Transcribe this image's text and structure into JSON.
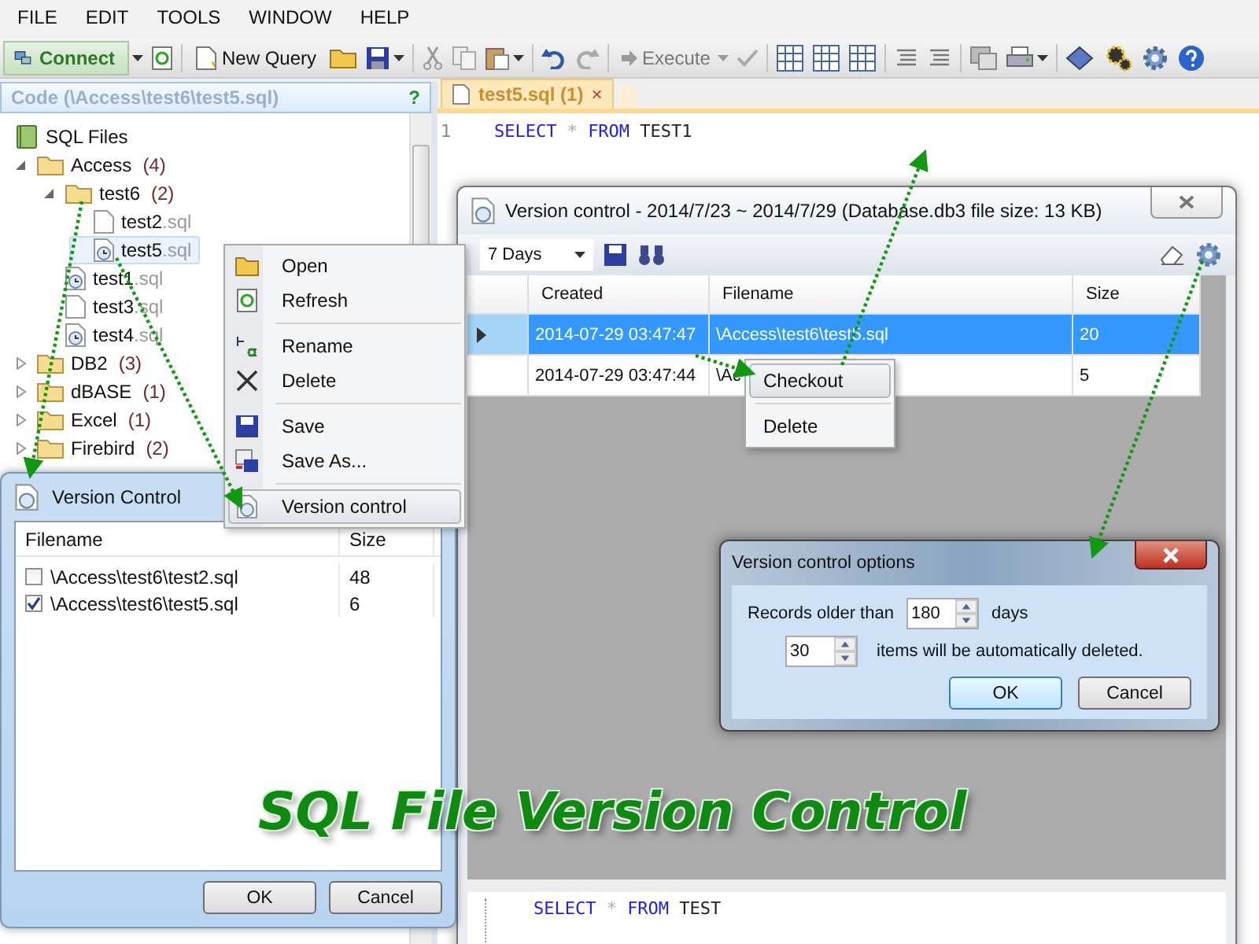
{
  "menu_bar": [
    "FILE",
    "EDIT",
    "TOOLS",
    "WINDOW",
    "HELP"
  ],
  "toolbar": {
    "connect": "Connect",
    "new_query": "New Query",
    "execute": {
      "label": "Execute",
      "disabled": true
    }
  },
  "code_panel": {
    "title": "Code (\\Access\\test6\\test5.sql)",
    "help": "?",
    "tree": [
      {
        "label": "SQL Files",
        "kind": "root",
        "children": [
          {
            "label": "Access",
            "count": "(4)",
            "kind": "folder",
            "expanded": true,
            "children": [
              {
                "label": "test6",
                "count": "(2)",
                "kind": "folder",
                "expanded": true,
                "children": [
                  {
                    "label": "test2",
                    "ext": ".sql",
                    "kind": "file",
                    "versioned": false,
                    "selected": false
                  },
                  {
                    "label": "test5",
                    "ext": ".sql",
                    "kind": "file",
                    "versioned": true,
                    "selected": true
                  }
                ]
              },
              {
                "label": "test1",
                "ext": ".sql",
                "kind": "file",
                "versioned": true,
                "selected": false
              },
              {
                "label": "test3",
                "ext": ".sql",
                "kind": "file",
                "versioned": false,
                "selected": false
              },
              {
                "label": "test4",
                "ext": ".sql",
                "kind": "file",
                "versioned": true,
                "selected": false
              }
            ]
          },
          {
            "label": "DB2",
            "count": "(3)",
            "kind": "folder",
            "expanded": false
          },
          {
            "label": "dBASE",
            "count": "(1)",
            "kind": "folder",
            "expanded": false
          },
          {
            "label": "Excel",
            "count": "(1)",
            "kind": "folder",
            "expanded": false
          },
          {
            "label": "Firebird",
            "count": "(2)",
            "kind": "folder",
            "expanded": false
          }
        ]
      }
    ]
  },
  "editor": {
    "tab": {
      "label": "test5.sql (1)",
      "close": "×"
    },
    "line_number": "1",
    "code": [
      {
        "text": "SELECT",
        "kind": "keyword"
      },
      {
        "text": "*",
        "kind": "operator"
      },
      {
        "text": "FROM",
        "kind": "keyword"
      },
      {
        "text": "TEST1",
        "kind": "identifier"
      }
    ]
  },
  "context_menu": [
    {
      "label": "Open",
      "separator_before": false,
      "selected": false
    },
    {
      "label": "Refresh",
      "separator_before": false,
      "selected": false
    },
    {
      "label": "Rename",
      "separator_before": true,
      "selected": false
    },
    {
      "label": "Delete",
      "separator_before": false,
      "selected": false
    },
    {
      "label": "Save",
      "separator_before": true,
      "selected": false
    },
    {
      "label": "Save As...",
      "separator_before": false,
      "selected": false
    },
    {
      "label": "Version control",
      "separator_before": true,
      "selected": true
    }
  ],
  "version_window": {
    "title": "Version control - 2014/7/23 ~ 2014/7/29 (Database.db3 file size: 13 KB)",
    "period": "7 Days",
    "columns": [
      "Created",
      "Filename",
      "Size"
    ],
    "rows": [
      {
        "created": "2014-07-29 03:47:47",
        "filename": "\\Access\\test6\\test5.sql",
        "size": "20",
        "selected": true
      },
      {
        "created": "2014-07-29 03:47:44",
        "filename": "\\Ac",
        "size": "5",
        "selected": false
      }
    ],
    "preview_code": [
      {
        "text": "SELECT",
        "kind": "keyword"
      },
      {
        "text": "*",
        "kind": "operator"
      },
      {
        "text": "FROM",
        "kind": "keyword"
      },
      {
        "text": "TEST",
        "kind": "identifier"
      }
    ]
  },
  "row_menu": [
    {
      "label": "Checkout",
      "selected": true,
      "separator_before": false
    },
    {
      "label": "Delete",
      "selected": false,
      "separator_before": true
    }
  ],
  "version_dialog": {
    "title": "Version Control",
    "columns": [
      "Filename",
      "Size"
    ],
    "rows": [
      {
        "filename": "\\Access\\test6\\test2.sql",
        "size": "48",
        "checked": false
      },
      {
        "filename": "\\Access\\test6\\test5.sql",
        "size": "6",
        "checked": true
      }
    ],
    "buttons": [
      "OK",
      "Cancel"
    ]
  },
  "options_dialog": {
    "title": "Version control options",
    "records_label": "Records older than",
    "days_value": "180",
    "days_unit": "days",
    "items_value": "30",
    "items_label": "items will be automatically deleted.",
    "buttons": [
      "OK",
      "Cancel"
    ]
  },
  "caption": "SQL File Version Control"
}
